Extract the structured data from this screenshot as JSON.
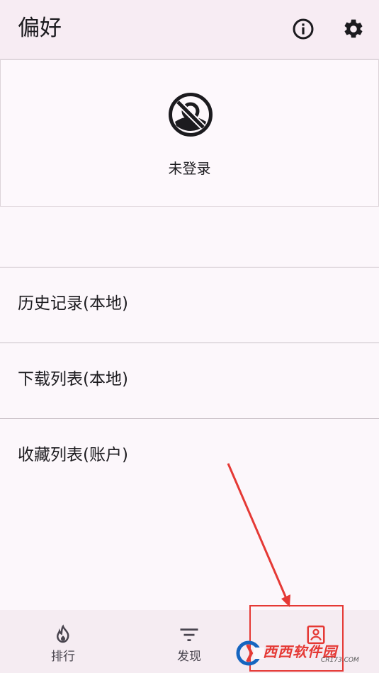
{
  "header": {
    "title": "偏好",
    "info_icon": "info-icon",
    "settings_icon": "gear-icon"
  },
  "profile": {
    "avatar_icon": "no-account-icon",
    "status": "未登录"
  },
  "menu": {
    "items": [
      {
        "label": "历史记录(本地)"
      },
      {
        "label": "下载列表(本地)"
      },
      {
        "label": "收藏列表(账户)"
      }
    ]
  },
  "bottom_nav": {
    "items": [
      {
        "label": "排行",
        "icon": "flame-icon"
      },
      {
        "label": "发现",
        "icon": "filter-icon"
      },
      {
        "label": "",
        "icon": "account-box-icon"
      }
    ]
  },
  "watermark": {
    "text": "西西软件园",
    "sub": "CR173.COM"
  },
  "colors": {
    "annotation": "#e53935",
    "appbar_bg": "#f7ecf3",
    "page_bg": "#fcf7fb"
  }
}
